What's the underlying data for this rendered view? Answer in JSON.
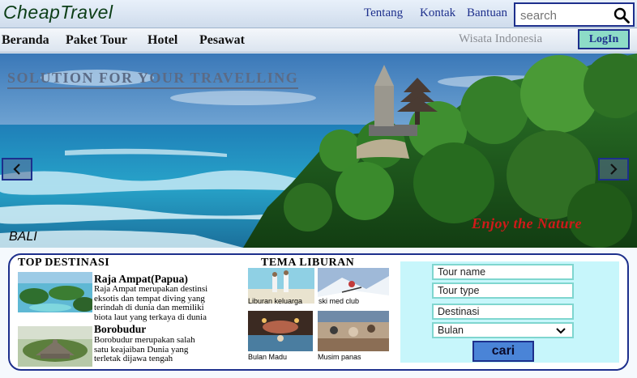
{
  "header": {
    "logo": "CheapTravel",
    "links": [
      "Tentang",
      "Kontak",
      "Bantuan"
    ],
    "search_placeholder": "search"
  },
  "nav": {
    "items": [
      "Beranda",
      "Paket Tour",
      "Hotel",
      "Pesawat"
    ],
    "site_label": "Wisata Indonesia",
    "login_label": "LogIn"
  },
  "hero": {
    "tagline": "SOLUTION FOR YOUR TRAVELLING",
    "location": "BALI",
    "slogan": "Enjoy the Nature"
  },
  "top_destinasi": {
    "title": "TOP DESTINASI",
    "items": [
      {
        "name": "Raja Ampat(Papua)",
        "desc_lines": [
          "Raja Ampat merupakan destinsi",
          "eksotis dan tempat diving yang",
          "terindah di dunia dan memiliki",
          "biota laut yang terkaya di dunia"
        ]
      },
      {
        "name": "Borobudur",
        "desc_lines": [
          "Borobudur merupakan salah",
          "satu keajaiban Dunia yang",
          "terletak dijawa tengah"
        ]
      }
    ]
  },
  "tema_liburan": {
    "title": "TEMA LIBURAN",
    "items": [
      "Liburan keluarga",
      "ski med club",
      "Bulan Madu",
      "Musim panas"
    ]
  },
  "search_form": {
    "fields": [
      "Tour name",
      "Tour type",
      "Destinasi"
    ],
    "month_select": "Bulan",
    "submit_label": "cari"
  }
}
